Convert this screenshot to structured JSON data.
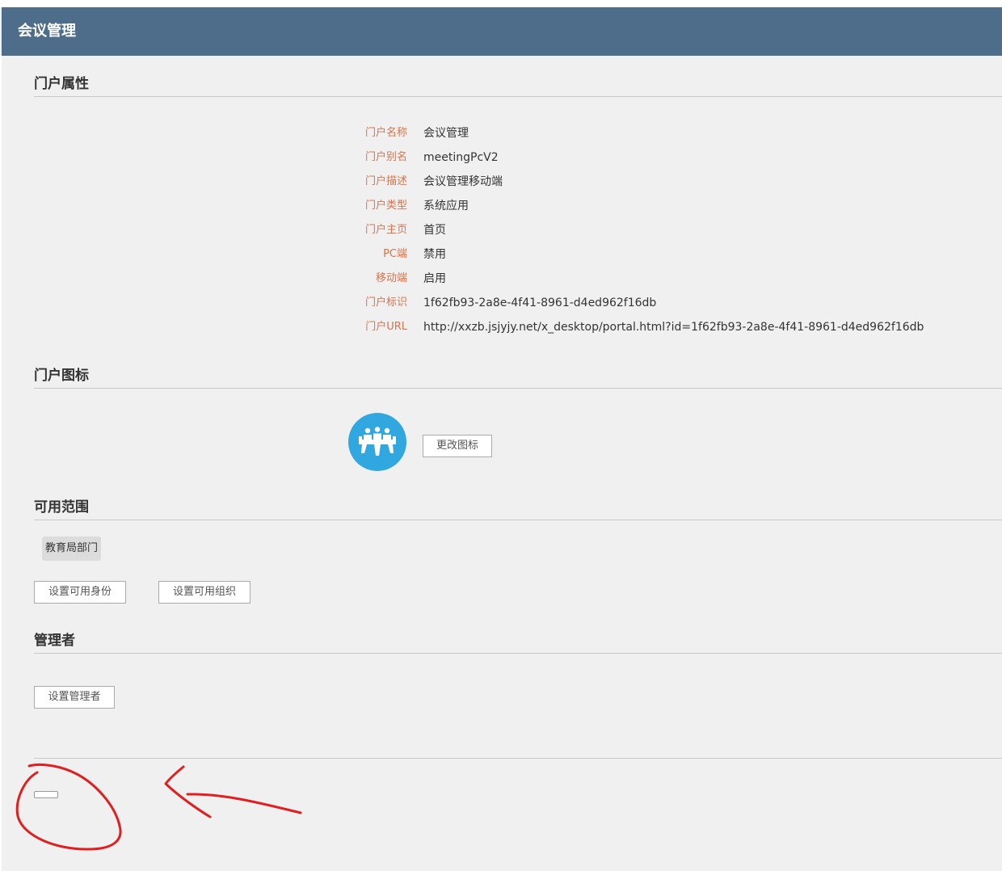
{
  "header": {
    "title": "会议管理"
  },
  "sections": {
    "properties": "门户属性",
    "icon": "门户图标",
    "scope": "可用范围",
    "admins": "管理者"
  },
  "properties": [
    {
      "label": "门户名称",
      "value": "会议管理"
    },
    {
      "label": "门户别名",
      "value": "meetingPcV2"
    },
    {
      "label": "门户描述",
      "value": "会议管理移动端"
    },
    {
      "label": "门户类型",
      "value": "系统应用"
    },
    {
      "label": "门户主页",
      "value": "首页"
    },
    {
      "label": "PC端",
      "value": "禁用"
    },
    {
      "label": "移动端",
      "value": "启用"
    },
    {
      "label": "门户标识",
      "value": "1f62fb93-2a8e-4f41-8961-d4ed962f16db"
    },
    {
      "label": "门户URL",
      "value": "http://xxzb.jsjyjy.net/x_desktop/portal.html?id=1f62fb93-2a8e-4f41-8961-d4ed962f16db"
    }
  ],
  "icon_section": {
    "icon": "meeting-people-icon",
    "color": "#31a7e0",
    "change_label": "更改图标"
  },
  "scope": {
    "tags": [
      "教育局部门"
    ],
    "set_identity_label": "设置可用身份",
    "set_org_label": "设置可用组织"
  },
  "admins": {
    "set_admin_label": "设置管理者"
  },
  "colors": {
    "header": "#4e6d8a",
    "label": "#d9734a",
    "annotation": "#e02020"
  }
}
